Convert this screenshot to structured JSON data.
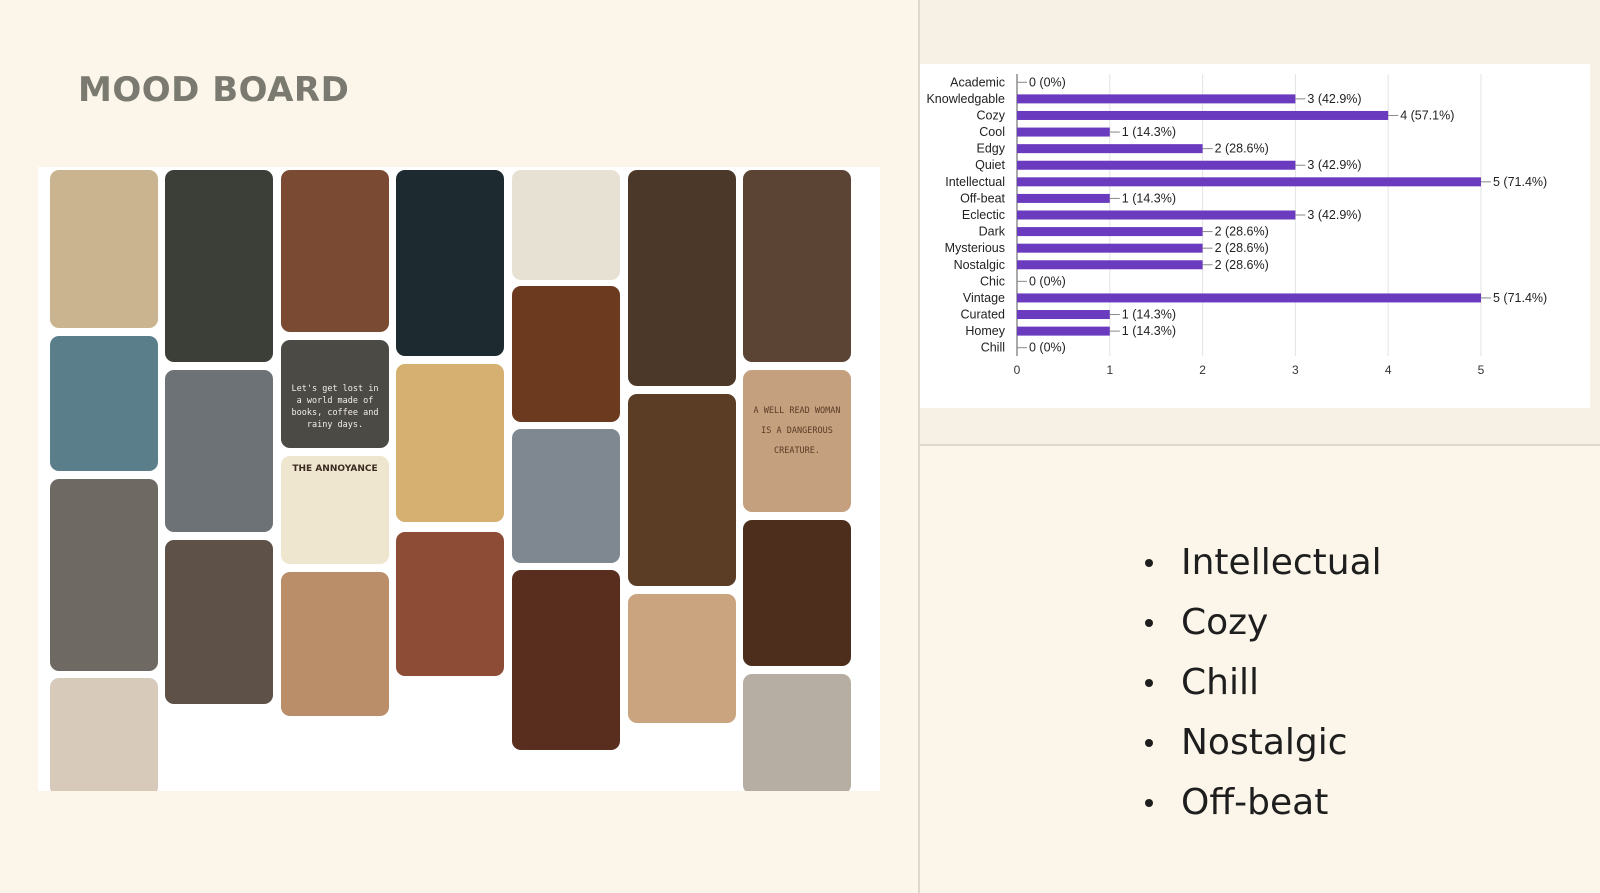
{
  "slide": {
    "title": "MOOD BOARD"
  },
  "moodboard": {
    "tiles": [
      {
        "name": "cat-in-suit-art",
        "color": "#c9b48f"
      },
      {
        "name": "library-ladder-photo",
        "color": "#3b3f38"
      },
      {
        "name": "woman-brick-wall-photo",
        "color": "#7a4a32"
      },
      {
        "name": "cassette-wall-photo",
        "color": "#1d2a30"
      },
      {
        "name": "fox-in-suit-art",
        "color": "#e7e1d4"
      },
      {
        "name": "coffee-books-collage",
        "color": "#4c3829"
      },
      {
        "name": "reader-cafe-photo",
        "color": "#5b4434"
      },
      {
        "name": "colorful-building-photo",
        "color": "#5a7e8a"
      },
      {
        "name": "berlin-wall-photo",
        "color": "#6d7276"
      },
      {
        "name": "quote-coffee-photo",
        "color": "#4c4a45",
        "text": "Let's get lost in a world made of books, coffee and rainy days."
      },
      {
        "name": "cat-hat-art",
        "color": "#d6b071"
      },
      {
        "name": "bookshop-interior-photo",
        "color": "#6b3a1f"
      },
      {
        "name": "paper-quote-card",
        "color": "#c4a07e",
        "text": "A WELL READ WOMAN IS A DANGEROUS CREATURE."
      },
      {
        "name": "annoyance-cat-poster",
        "color": "#efe6d0",
        "text": "THE ANNOYANCE"
      },
      {
        "name": "open-book-mug-photo",
        "color": "#6e6a63"
      },
      {
        "name": "city-train-photo",
        "color": "#7f8791"
      },
      {
        "name": "stacked-books-photo",
        "color": "#8a7c6a"
      },
      {
        "name": "librarian-books-photo",
        "color": "#5b3d25"
      },
      {
        "name": "open-books-pile-photo",
        "color": "#5e5148"
      },
      {
        "name": "piled-books-photo",
        "color": "#b98e68"
      },
      {
        "name": "cozy-knit-book-photo",
        "color": "#8c4c35"
      },
      {
        "name": "dark-bookshelf-photo",
        "color": "#4d2e1c"
      },
      {
        "name": "library-aisle-photo",
        "color": "#5a2e1e"
      },
      {
        "name": "street-pipes-photo",
        "color": "#c9a47e"
      },
      {
        "name": "book-flowers-photo",
        "color": "#d8cabb"
      },
      {
        "name": "camera-blanket-photo",
        "color": "#b7aea3"
      }
    ]
  },
  "chart_data": {
    "type": "bar",
    "orientation": "horizontal",
    "categories": [
      "Academic",
      "Knowledgable",
      "Cozy",
      "Cool",
      "Edgy",
      "Quiet",
      "Intellectual",
      "Off-beat",
      "Eclectic",
      "Dark",
      "Mysterious",
      "Nostalgic",
      "Chic",
      "Vintage",
      "Curated",
      "Homey",
      "Chill"
    ],
    "values": [
      0,
      3,
      4,
      1,
      2,
      3,
      5,
      1,
      3,
      2,
      2,
      2,
      0,
      5,
      1,
      1,
      0
    ],
    "value_labels": [
      "0 (0%)",
      "3 (42.9%)",
      "4 (57.1%)",
      "1 (14.3%)",
      "2 (28.6%)",
      "3 (42.9%)",
      "5 (71.4%)",
      "1 (14.3%)",
      "3 (42.9%)",
      "2 (28.6%)",
      "2 (28.6%)",
      "2 (28.6%)",
      "0 (0%)",
      "5 (71.4%)",
      "1 (14.3%)",
      "1 (14.3%)",
      "0 (0%)"
    ],
    "x_ticks": [
      "0",
      "1",
      "2",
      "3",
      "4",
      "5"
    ],
    "xlim": [
      0,
      5
    ],
    "bar_color": "#6a3bbf",
    "grid": true
  },
  "bullets": [
    "Intellectual",
    "Cozy",
    "Chill",
    "Nostalgic",
    "Off-beat"
  ]
}
